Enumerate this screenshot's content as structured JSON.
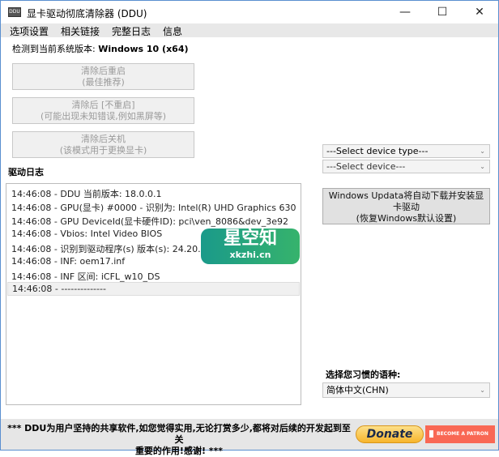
{
  "window": {
    "title": "显卡驱动彻底清除器 (DDU)",
    "icon": "ddu-app-icon",
    "controls": {
      "minimize": "—",
      "maximize": "☐",
      "close": "✕"
    }
  },
  "menu": [
    "选项设置",
    "相关链接",
    "完整日志",
    "信息"
  ],
  "os_label": "检测到当前系统版本: ",
  "os_value": "Windows 10 (x64)",
  "buttons": [
    {
      "line1": "清除后重启",
      "line2": "(最佳推荐)"
    },
    {
      "line1": "清除后 [不重启]",
      "line2": "(可能出现未知错误,例如黑屏等)"
    },
    {
      "line1": "清除后关机",
      "line2": "(该模式用于更换显卡)"
    }
  ],
  "log": {
    "title": "驱动日志",
    "lines": [
      "14:46:08 - DDU 当前版本: 18.0.0.1",
      "14:46:08 - GPU(显卡) #0000 - 识别为: Intel(R) UHD Graphics 630",
      "14:46:08 - GPU DeviceId(显卡硬件ID): pci\\ven_8086&dev_3e92",
      "14:46:08 - Vbios: Intel Video BIOS",
      "14:46:08 - 识别到驱动程序(s) 版本(s): 24.20.100",
      "14:46:08 - INF: oem17.inf",
      "14:46:08 - INF 区间: iCFL_w10_DS",
      "14:46:08 - --------------"
    ]
  },
  "device_type_select": "---Select device type---",
  "device_select": "---Select device---",
  "windows_update_button": {
    "line1": "Windows Updata将自动下载并安装显",
    "line2": "卡驱动",
    "line3": "(恢复Windows默认设置)"
  },
  "language": {
    "label": "选择您习惯的语种:",
    "value": "简体中文(CHN)"
  },
  "footer": {
    "line1": "*** DDU为用户坚持的共享软件,如您觉得实用,无论打赏多少,都将对后续的开发起到至关",
    "line2": "重要的作用!感谢! ***",
    "donate": "Donate",
    "patreon": "BECOME A PATRON"
  },
  "watermark": {
    "text": "星空知",
    "url": "xkzhi.cn"
  },
  "colors": {
    "accent": "#5a8fd0",
    "donate": "#f7b52c",
    "patreon": "#f96854"
  }
}
